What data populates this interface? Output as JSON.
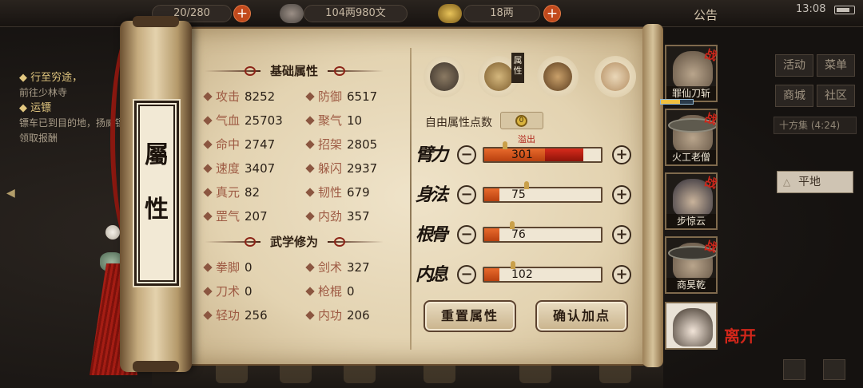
{
  "topbar": {
    "stamina": "20/280",
    "silver": "104两980文",
    "gold": "18两",
    "notice": "公告",
    "time": "13:08"
  },
  "quest": {
    "q1_title": "行至穷途，",
    "q1_desc": "前往少林寺",
    "q2_title": "运镖",
    "q2_desc": "镖车已到目的地，扬威镖局领取报酬"
  },
  "right_menu": {
    "activity": "活动",
    "menu": "菜单",
    "shop": "商城",
    "community": "社区",
    "shifang": "十方集",
    "shifang_time": "(4:24)",
    "terrain": "平地"
  },
  "scroll": {
    "title_top": "屬",
    "title_bottom": "性"
  },
  "basic_attrs": {
    "header": "基础属性",
    "items": [
      {
        "label": "攻击",
        "value": "8252"
      },
      {
        "label": "防御",
        "value": "6517"
      },
      {
        "label": "气血",
        "value": "25703"
      },
      {
        "label": "聚气",
        "value": "10"
      },
      {
        "label": "命中",
        "value": "2747"
      },
      {
        "label": "招架",
        "value": "2805"
      },
      {
        "label": "速度",
        "value": "3407"
      },
      {
        "label": "躲闪",
        "value": "2937"
      },
      {
        "label": "真元",
        "value": "82"
      },
      {
        "label": "韧性",
        "value": "679"
      },
      {
        "label": "罡气",
        "value": "207"
      },
      {
        "label": "内劲",
        "value": "357"
      }
    ]
  },
  "martial": {
    "header": "武学修为",
    "items": [
      {
        "label": "拳脚",
        "value": "0"
      },
      {
        "label": "剑术",
        "value": "327"
      },
      {
        "label": "刀术",
        "value": "0"
      },
      {
        "label": "枪棍",
        "value": "0"
      },
      {
        "label": "轻功",
        "value": "256"
      },
      {
        "label": "内功",
        "value": "206"
      }
    ]
  },
  "panel": {
    "tag": "属性",
    "free_points_label": "自由属性点数",
    "free_points": "0",
    "overflow_label": "溢出",
    "attributes": [
      {
        "label": "臂力",
        "value": "301",
        "fraction": 0.52,
        "overflow": 0.33
      },
      {
        "label": "身法",
        "value": "75",
        "fraction": 0.13,
        "overflow": 0
      },
      {
        "label": "根骨",
        "value": "76",
        "fraction": 0.13,
        "overflow": 0
      },
      {
        "label": "内息",
        "value": "102",
        "fraction": 0.13,
        "overflow": 0
      }
    ],
    "reset_button": "重置属性",
    "confirm_button": "确认加点"
  },
  "party": {
    "members": [
      {
        "name": "罪仙刀斩"
      },
      {
        "name": "火工老僧"
      },
      {
        "name": "步惊云"
      },
      {
        "name": "商昊乾"
      }
    ],
    "battle_mark": "战",
    "leave_label": "离开"
  },
  "colors": {
    "accent_red": "#d0261a",
    "bar_fill": "#e86a2c",
    "overflow_fill": "#d82b1c",
    "label_color": "#9e5b44"
  }
}
